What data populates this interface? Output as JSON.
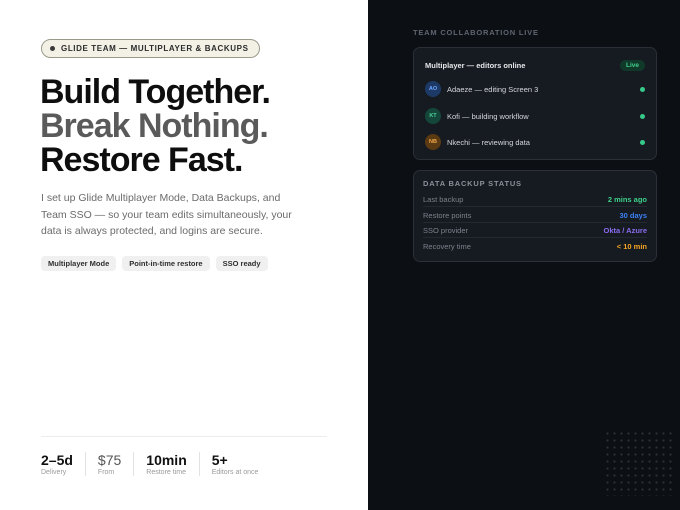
{
  "badge": {
    "text": "GLIDE TEAM — MULTIPLAYER & BACKUPS"
  },
  "headline": {
    "line1": "Build Together.",
    "line2": "Break Nothing.",
    "line3": "Restore Fast."
  },
  "description": "I set up Glide Multiplayer Mode, Data Backups, and Team SSO — so your team edits simultaneously, your data is always protected, and logins are secure.",
  "chips": [
    "Multiplayer Mode",
    "Point-in-time restore",
    "SSO ready"
  ],
  "stats": [
    {
      "value": "2–5d",
      "label": "Delivery"
    },
    {
      "value": "$75",
      "label": "From"
    },
    {
      "value": "10min",
      "label": "Restore time"
    },
    {
      "value": "5+",
      "label": "Editors at once"
    }
  ],
  "panel": {
    "section_title": "TEAM COLLABORATION LIVE",
    "collab": {
      "title": "Multiplayer — editors online",
      "status": "Live",
      "editors": [
        {
          "initials": "AO",
          "text": "Adaeze — editing Screen 3",
          "avatar_bg": "#1d3a66",
          "avatar_fg": "#6fa6ff"
        },
        {
          "initials": "KT",
          "text": "Kofi — building workflow",
          "avatar_bg": "#14473a",
          "avatar_fg": "#4fd19a"
        },
        {
          "initials": "NB",
          "text": "Nkechi — reviewing data",
          "avatar_bg": "#5a3a12",
          "avatar_fg": "#f0a84a"
        }
      ]
    },
    "backup": {
      "title": "DATA BACKUP STATUS",
      "rows": [
        {
          "label": "Last backup",
          "value": "2 mins ago",
          "color": "#3fd08a"
        },
        {
          "label": "Restore points",
          "value": "30 days",
          "color": "#3b82f6"
        },
        {
          "label": "SSO provider",
          "value": "Okta / Azure",
          "color": "#8b6cf0"
        },
        {
          "label": "Recovery time",
          "value": "< 10 min",
          "color": "#f5a524"
        }
      ]
    }
  }
}
